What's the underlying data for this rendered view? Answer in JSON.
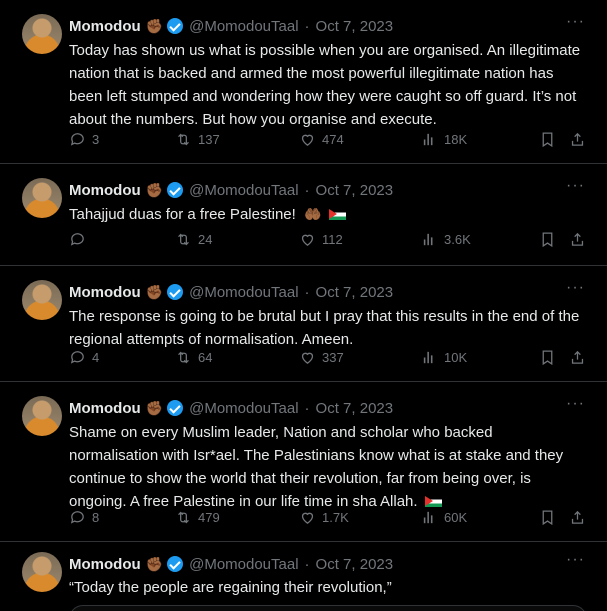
{
  "tweets": [
    {
      "name": "Momodou",
      "emoji": "✊🏾",
      "handle": "@MomodouTaal",
      "date": "Oct 7, 2023",
      "text": "Today has shown us what is possible when you are organised. An illegitimate nation that is backed and armed the most powerful illegitimate nation has been left stumped and wondering how they were caught so off guard. It’s not about the numbers. But how you organise and execute.",
      "replies": "3",
      "reposts": "137",
      "likes": "474",
      "views": "18K"
    },
    {
      "name": "Momodou",
      "emoji": "✊🏾",
      "handle": "@MomodouTaal",
      "date": "Oct 7, 2023",
      "text": "Tahajjud duas for a free Palestine!",
      "text_emoji": "🤲🏾",
      "replies": "",
      "reposts": "24",
      "likes": "112",
      "views": "3.6K"
    },
    {
      "name": "Momodou",
      "emoji": "✊🏾",
      "handle": "@MomodouTaal",
      "date": "Oct 7, 2023",
      "text": "The response is going to be brutal but I pray that this results in the end of the regional attempts of normalisation. Ameen.",
      "replies": "4",
      "reposts": "64",
      "likes": "337",
      "views": "10K"
    },
    {
      "name": "Momodou",
      "emoji": "✊🏾",
      "handle": "@MomodouTaal",
      "date": "Oct 7, 2023",
      "text": "Shame on every Muslim leader, Nation and scholar who backed normalisation with Isr*ael. The Palestinians know what is at stake and they continue to show the world that their revolution, far from being over, is ongoing. A free Palestine in our life time in sha Allah.",
      "replies": "8",
      "reposts": "479",
      "likes": "1.7K",
      "views": "60K"
    },
    {
      "name": "Momodou",
      "emoji": "✊🏾",
      "handle": "@MomodouTaal",
      "date": "Oct 7, 2023",
      "text": "“Today the people are regaining their revolution,”"
    }
  ],
  "separator": "·",
  "more_glyph": "···",
  "colors": {
    "accent": "#1d9bf0",
    "muted": "#71767b",
    "border": "#2f3336",
    "background": "#000000"
  }
}
